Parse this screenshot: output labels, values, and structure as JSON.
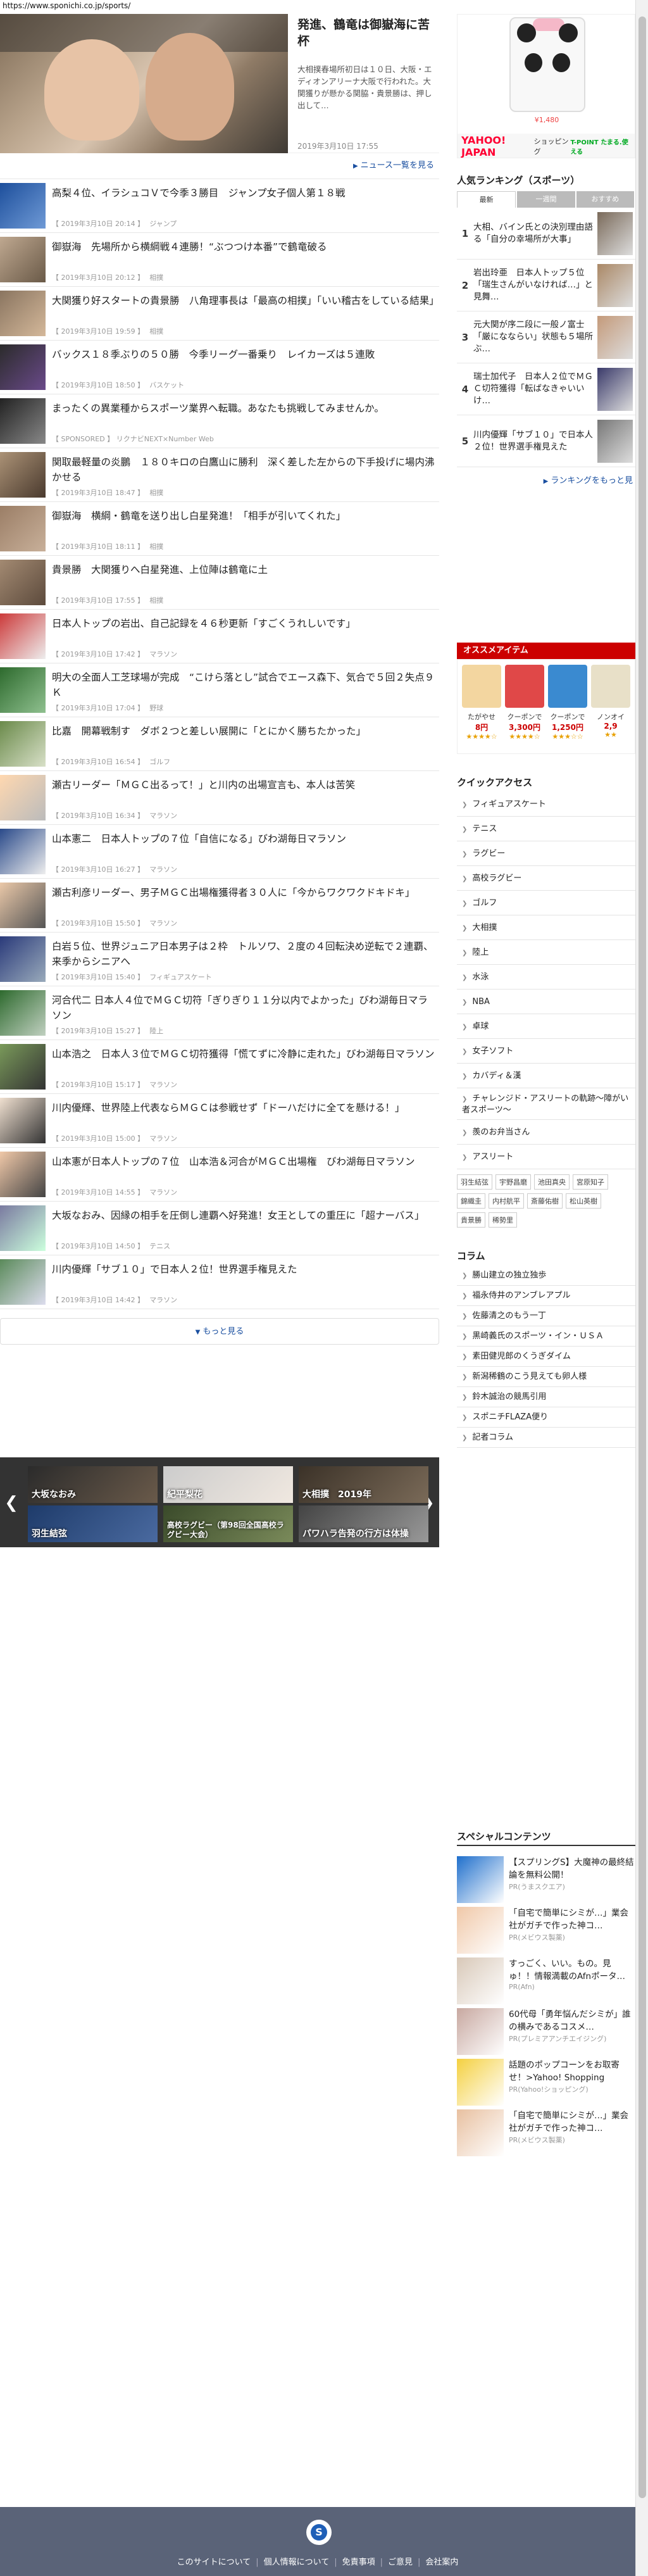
{
  "url": "https://www.sponichi.co.jp/sports/",
  "top_story": {
    "title": "発進、鶴竜は御嶽海に苦杯",
    "body": "大相撲春場所初日は１０日、大阪・エディオンアリーナ大阪で行われた。大関獲りが懸かる関脇・貴景勝は、押し出して…",
    "date": "2019年3月10日 17:55"
  },
  "news_list_link": "ニュース一覧を見る",
  "news": [
    {
      "title": "高梨４位、イラシュコＶで今季３勝目　ジャンプ女子個人第１８戦",
      "date": "【 2019年3月10日 20:14 】",
      "cat": "ジャンプ"
    },
    {
      "title": "御嶽海　先場所から横綱戦４連勝！“ぶつつけ本番”で鶴竜破る",
      "date": "【 2019年3月10日 20:12 】",
      "cat": "相撲"
    },
    {
      "title": "大関獲り好スタートの貴景勝　八角理事長は「最高の相撲」「いい稽古をしている結果」",
      "date": "【 2019年3月10日 19:59 】",
      "cat": "相撲"
    },
    {
      "title": "バックス１８季ぶりの５０勝　今季リーグ一番乗り　レイカーズは５連敗",
      "date": "【 2019年3月10日 18:50 】",
      "cat": "バスケット"
    },
    {
      "title": "まったくの異業種からスポーツ業界へ転職。あなたも挑戦してみませんか。",
      "date": "【 SPONSORED 】 リクナビNEXT×Number Web",
      "cat": ""
    },
    {
      "title": "関取最軽量の炎鵬　１８０キロの白鷹山に勝利　深く差した左からの下手投げに場内沸かせる",
      "date": "【 2019年3月10日 18:47 】",
      "cat": "相撲"
    },
    {
      "title": "御嶽海　横綱・鶴竜を送り出し白星発進！「相手が引いてくれた」",
      "date": "【 2019年3月10日 18:11 】",
      "cat": "相撲"
    },
    {
      "title": "貴景勝　大関獲りへ白星発進、上位陣は鶴竜に土",
      "date": "【 2019年3月10日 17:55 】",
      "cat": "相撲"
    },
    {
      "title": "日本人トップの岩出、自己記録を４６秒更新「すごくうれしいです」",
      "date": "【 2019年3月10日 17:42 】",
      "cat": "マラソン"
    },
    {
      "title": "明大の全面人工芝球場が完成　“こけら落とし”試合でエース森下、気合で５回２失点９Ｋ",
      "date": "【 2019年3月10日 17:04 】",
      "cat": "野球"
    },
    {
      "title": "比嘉　開幕戦制す　ダボ２つと差しい展開に「とにかく勝ちたかった」",
      "date": "【 2019年3月10日 16:54 】",
      "cat": "ゴルフ"
    },
    {
      "title": "瀬古リーダー「ＭＧＣ出るって！」と川内の出場宣言も、本人は苦笑",
      "date": "【 2019年3月10日 16:34 】",
      "cat": "マラソン"
    },
    {
      "title": "山本憲二　日本人トップの７位「自信になる」びわ湖毎日マラソン",
      "date": "【 2019年3月10日 16:27 】",
      "cat": "マラソン"
    },
    {
      "title": "瀬古利彦リーダー、男子ＭＧＣ出場権獲得者３０人に「今からワクワクドキドキ」",
      "date": "【 2019年3月10日 15:50 】",
      "cat": "マラソン"
    },
    {
      "title": "白岩５位、世界ジュニア日本男子は２枠　トルソワ、２度の４回転決め逆転で２連覇、来季からシニアへ",
      "date": "【 2019年3月10日 15:40 】",
      "cat": "フィギュアスケート"
    },
    {
      "title": "河合代二 日本人４位でＭＧＣ切符「ぎりぎり１１分以内でよかった」びわ湖毎日マラソン",
      "date": "【 2019年3月10日 15:27 】",
      "cat": "陸上"
    },
    {
      "title": "山本浩之　日本人３位でＭＧＣ切符獲得「慌てずに冷静に走れた」びわ湖毎日マラソン",
      "date": "【 2019年3月10日 15:17 】",
      "cat": "マラソン"
    },
    {
      "title": "川内優輝、世界陸上代表ならＭＧＣは参戦せず「ドーハだけに全てを懸ける！」",
      "date": "【 2019年3月10日 15:00 】",
      "cat": "マラソン"
    },
    {
      "title": "山本憲が日本人トップの７位　山本浩＆河合がＭＧＣ出場権　びわ湖毎日マラソン",
      "date": "【 2019年3月10日 14:55 】",
      "cat": "マラソン"
    },
    {
      "title": "大坂なおみ、因縁の相手を圧倒し連覇へ好発進！女王としての重圧に「超ナーバス」",
      "date": "【 2019年3月10日 14:50 】",
      "cat": "テニス"
    },
    {
      "title": "川内優輝「サブ１０」で日本人２位！世界選手権見えた",
      "date": "【 2019年3月10日 14:42 】",
      "cat": "マラソン"
    }
  ],
  "more_button": "もっと見る",
  "carousel": [
    "大坂なおみ",
    "紀平梨花",
    "大相撲　2019年",
    "羽生結弦",
    "高校ラグビー（第98回全国高校ラグビー大会）",
    "パワハラ告発の行方は体操"
  ],
  "ad": {
    "price": "¥1,480",
    "yahoo": "YAHOO! JAPAN",
    "shopping": "ショッピング",
    "tpoint": "T-POINT たまる.使える"
  },
  "ranking": {
    "heading": "人気ランキング（スポーツ）",
    "tabs": [
      "最新",
      "一週間",
      "おすすめ"
    ],
    "items": [
      {
        "num": "1",
        "text": "大相、バイン氏との決別理由語る「自分の幸場所が大事」"
      },
      {
        "num": "2",
        "text": "岩出玲亜　日本人トップ５位「瑞生さんがいなければ…」と見舞…"
      },
      {
        "num": "3",
        "text": "元大関が序二段に一般ノ富士「厳になならい」状態も５場所ぶ…"
      },
      {
        "num": "4",
        "text": "瑞士加代子　日本人２位でＭＧＣ切符獲得「転ばなきゃいいけ…"
      },
      {
        "num": "5",
        "text": "川内優輝「サブ１０」で日本人２位！世界選手権見えた"
      }
    ],
    "more": "ランキングをもっと見"
  },
  "osusume": {
    "heading": "オススメアイテム",
    "items": [
      {
        "title": "たがやせ",
        "price": "8円"
      },
      {
        "title": "クーポンで",
        "price": "3,300円"
      },
      {
        "title": "クーポンで",
        "price": "1,250円"
      },
      {
        "title": "ノンオイ",
        "price": "2,9"
      }
    ],
    "stars": [
      "★★★★☆",
      "★★★★☆",
      "★★★☆☆",
      "★★"
    ]
  },
  "quick_access": {
    "heading": "クイックアクセス",
    "items": [
      "フィギュアスケート",
      "テニス",
      "ラグビー",
      "高校ラグビー",
      "ゴルフ",
      "大相撲",
      "陸上",
      "水泳",
      "NBA",
      "卓球",
      "女子ソフト",
      "カバディ＆漢",
      "チャレンジド・アスリートの軌跡〜障がい者スポーツ〜",
      "羨のお弁当さん",
      "アスリート"
    ],
    "tags": [
      "羽生結弦",
      "宇野昌磨",
      "池田真央",
      "宮原知子",
      "錦織圭",
      "内村航平",
      "斎藤佑樹",
      "松山英樹",
      "貴景勝",
      "稀勢里"
    ]
  },
  "column": {
    "heading": "コラム",
    "items": [
      "勝山建立の独立独歩",
      "福永侍井のアンブレアプル",
      "佐藤清之のもう一丁",
      "黒崎義氏のスポーツ・イン・ＵＳＡ",
      "素田健児郎のくうぎダイム",
      "新潟稀鶴のこう見えても卵人様",
      "鈴木誠治の競馬引用",
      "スポニチFLAZA便り",
      "記者コラム"
    ]
  },
  "special": {
    "heading": "スペシャルコンテンツ",
    "items": [
      {
        "title": "【スプリングS】大魔神の最終結論を無料公開！",
        "pr": "PR(うまスクエア)"
      },
      {
        "title": "「自宅で簡単にシミが…」業会社がガチで作った神コ…",
        "pr": "PR(メビウス製薬)"
      },
      {
        "title": "すっごく、いい。もの。見ゅ！！情報満載のAfnポータ…",
        "pr": "PR(Afn)"
      },
      {
        "title": "60代母「勇年悩んだシミが」誰の横みであるコスメ…",
        "pr": "PR(プレミアアンチエイジング)"
      },
      {
        "title": "話題のポップコーンをお取寄せ！>Yahoo! Shopping",
        "pr": "PR(Yahoo!ショッピング)"
      },
      {
        "title": "「自宅で簡単にシミが…」業会社がガチで作った神コ…",
        "pr": "PR(メビウス製薬)"
      }
    ]
  },
  "footer": {
    "links": [
      "このサイトについて",
      "個人情報について",
      "免責事項",
      "ご意見",
      "会社案内"
    ],
    "logo": "S"
  }
}
